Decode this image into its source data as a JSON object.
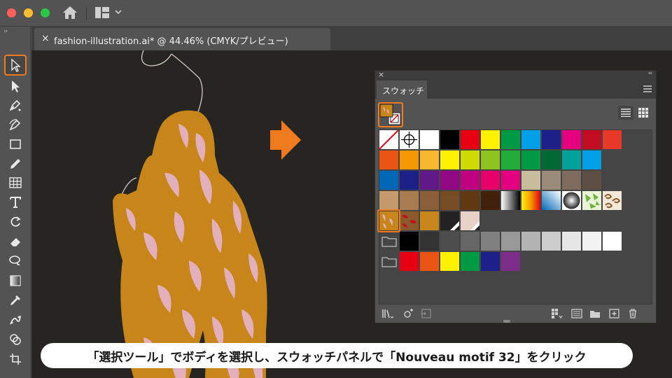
{
  "titlebar": {
    "traffic_lights": [
      "#ff5f57",
      "#febc2e",
      "#28c840"
    ],
    "home_icon": "home-icon",
    "workspace_icon": "workspace-switcher-icon"
  },
  "tools": {
    "collapse_label": "››",
    "items": [
      "selection-tool",
      "direct-selection-tool",
      "pen-tool",
      "curvature-tool",
      "rectangle-tool",
      "pencil-tool",
      "grid-tool",
      "type-tool",
      "rotate-tool",
      "eraser-tool",
      "lasso-tool",
      "gradient-tool",
      "eyedropper-tool",
      "puppet-warp-tool",
      "shape-builder-tool",
      "artboard-tool"
    ],
    "active": "selection-tool"
  },
  "document": {
    "tab_close": "×",
    "tab_title": "fashion-illustration.ai* @ 44.46% (CMYK/プレビュー)"
  },
  "panel": {
    "close": "×",
    "collapse": "‹‹",
    "tab_label": "スウォッチ",
    "highlight_color": "#f07b1f"
  },
  "swatches": {
    "row1": [
      "none",
      "registration",
      "#ffffff",
      "#000000",
      "#e60012",
      "#fff100",
      "#009944",
      "#00a0e9",
      "#1d2088",
      "#e4007f",
      "#c30d23",
      "#e83828"
    ],
    "row2": [
      "#ea5514",
      "#f39800",
      "#f8b62d",
      "#fff100",
      "#cfdb00",
      "#8fc31f",
      "#22ac38",
      "#009944",
      "#006934",
      "#00a29a",
      "#00a0e9"
    ],
    "row3": [
      "#0068b7",
      "#1d2088",
      "#601986",
      "#920783",
      "#be0081",
      "#e5006a",
      "#e4007f",
      "#c9bc9c",
      "#9a8b7b",
      "#7d6b5d",
      "#5e4f45"
    ],
    "row4": [
      "#c49a6c",
      "#a97c50",
      "#8b5e3c",
      "#754c24",
      "#603913",
      "#42210b",
      "gradient-black-white",
      "gradient-orange",
      "pattern-dots-blue",
      "pattern-radial-dots",
      "pattern-green-leaves",
      "pattern-brown-swirls"
    ],
    "row5": [
      "pattern-nouveau-motif-32",
      "pattern-red-floral",
      "#c8861a",
      "group-dark",
      "group-light"
    ],
    "grays": [
      "#000000",
      "#333333",
      "#4d4d4d",
      "#666666",
      "#808080",
      "#999999",
      "#b3b3b3",
      "#cccccc",
      "#e6e6e6",
      "#f2f2f2",
      "#ffffff"
    ],
    "brights": [
      "#e60012",
      "#ea5514",
      "#fff100",
      "#009944",
      "#1d2088",
      "#7d2e8a"
    ]
  },
  "footer_icons": [
    "swatch-libraries-icon",
    "place-swatch-icon",
    "swatch-options-icon",
    "show-kinds-icon",
    "new-color-group-icon",
    "new-folder-icon",
    "new-swatch-icon",
    "delete-swatch-icon"
  ],
  "artwork": {
    "body_color": "#c8861a",
    "pattern_color": "#e2b0bd",
    "line_color": "#d9c9c3"
  },
  "caption": "「選択ツール」でボディを選択し、スウォッチパネルで「Nouveau motif 32」をクリック"
}
